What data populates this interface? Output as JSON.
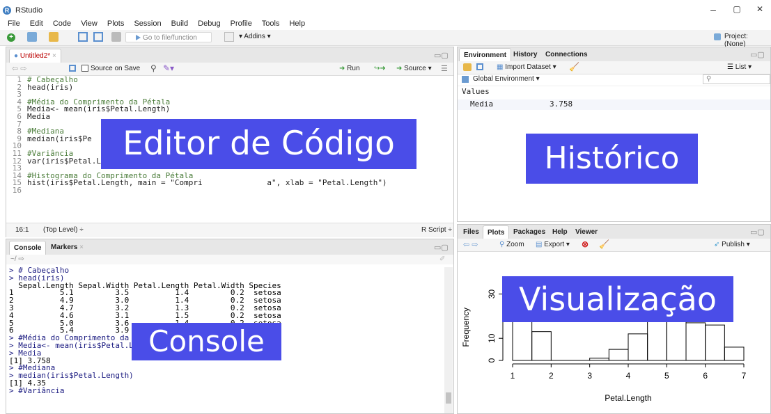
{
  "window": {
    "title": "RStudio",
    "minimize": "–",
    "maximize": "▢",
    "close": "✕"
  },
  "menu": [
    "File",
    "Edit",
    "Code",
    "View",
    "Plots",
    "Session",
    "Build",
    "Debug",
    "Profile",
    "Tools",
    "Help"
  ],
  "toolbar": {
    "goto_placeholder": "Go to file/function",
    "addins": "Addins",
    "project": "Project: (None)"
  },
  "editor": {
    "tab": "Untitled2*",
    "source_on_save": "Source on Save",
    "run": "Run",
    "source": "Source",
    "lines": [
      {
        "n": "1",
        "t": "# Cabeçalho",
        "k": "cmt"
      },
      {
        "n": "2",
        "t": "head(iris)",
        "k": ""
      },
      {
        "n": "3",
        "t": "",
        "k": ""
      },
      {
        "n": "4",
        "t": "#Média do Comprimento da Pétala",
        "k": "cmt"
      },
      {
        "n": "5",
        "t": "Media<- mean(iris$Petal.Length)",
        "k": ""
      },
      {
        "n": "6",
        "t": "Media",
        "k": ""
      },
      {
        "n": "7",
        "t": "",
        "k": ""
      },
      {
        "n": "8",
        "t": "#Mediana",
        "k": "cmt"
      },
      {
        "n": "9",
        "t": "median(iris$Pe",
        "k": ""
      },
      {
        "n": "10",
        "t": "",
        "k": ""
      },
      {
        "n": "11",
        "t": "#Variância",
        "k": "cmt"
      },
      {
        "n": "12",
        "t": "var(iris$Petal.Length)",
        "k": ""
      },
      {
        "n": "13",
        "t": "",
        "k": ""
      },
      {
        "n": "14",
        "t": "#Histograma do Comprimento da Pétala",
        "k": "cmt"
      },
      {
        "n": "15",
        "t": "hist(iris$Petal.Length, main = \"Compri              a\", xlab = \"Petal.Length\")",
        "k": ""
      },
      {
        "n": "16",
        "t": "",
        "k": ""
      }
    ],
    "status_pos": "16:1",
    "status_scope": "(Top Level) ÷",
    "status_type": "R Script ÷",
    "overlay": "Editor de Código"
  },
  "console": {
    "tabs": [
      "Console",
      "Markers"
    ],
    "path": "~/",
    "lines": [
      "> # Cabeçalho",
      "> head(iris)",
      "  Sepal.Length Sepal.Width Petal.Length Petal.Width Species",
      "1          5.1         3.5          1.4         0.2  setosa",
      "2          4.9         3.0          1.4         0.2  setosa",
      "3          4.7         3.2          1.3         0.2  setosa",
      "4          4.6         3.1          1.5         0.2  setosa",
      "5          5.0         3.6          1.4         0.2  setosa",
      "6          5.4         3.9          1.7         0.4  setosa",
      "> #Média do Comprimento da Pétala",
      "> Media<- mean(iris$Petal.Length)",
      "> Media",
      "[1] 3.758",
      "> #Mediana",
      "> median(iris$Petal.Length)",
      "[1] 4.35",
      "> #Variância"
    ],
    "overlay": "Console"
  },
  "environment": {
    "tabs": [
      "Environment",
      "History",
      "Connections"
    ],
    "import": "Import Dataset",
    "list": "List",
    "scope": "Global Environment",
    "section": "Values",
    "values": [
      {
        "name": "Media",
        "value": "3.758"
      }
    ],
    "overlay": "Histórico"
  },
  "files": {
    "tabs": [
      "Files",
      "Plots",
      "Packages",
      "Help",
      "Viewer"
    ],
    "zoom": "Zoom",
    "export": "Export",
    "publish": "Publish",
    "overlay": "Visualização"
  },
  "chart_data": {
    "type": "bar",
    "title": "",
    "xlabel": "Petal.Length",
    "ylabel": "Frequency",
    "xlim": [
      1,
      7
    ],
    "x_ticks": [
      "1",
      "2",
      "3",
      "4",
      "5",
      "6",
      "7"
    ],
    "y_ticks": [
      "0",
      "10",
      "30"
    ],
    "bins": [
      [
        1,
        1.5,
        37
      ],
      [
        1.5,
        2,
        13
      ],
      [
        2,
        2.5,
        0
      ],
      [
        2.5,
        3,
        0
      ],
      [
        3,
        3.5,
        1
      ],
      [
        3.5,
        4,
        5
      ],
      [
        4,
        4.5,
        12
      ],
      [
        4.5,
        5,
        22
      ],
      [
        5,
        5.5,
        22
      ],
      [
        5.5,
        6,
        17
      ],
      [
        6,
        6.5,
        16
      ],
      [
        6.5,
        7,
        6
      ]
    ]
  },
  "colors": {
    "overlay": "#4a4de8",
    "comment": "#4b7d3a",
    "console": "#1a1a80"
  }
}
